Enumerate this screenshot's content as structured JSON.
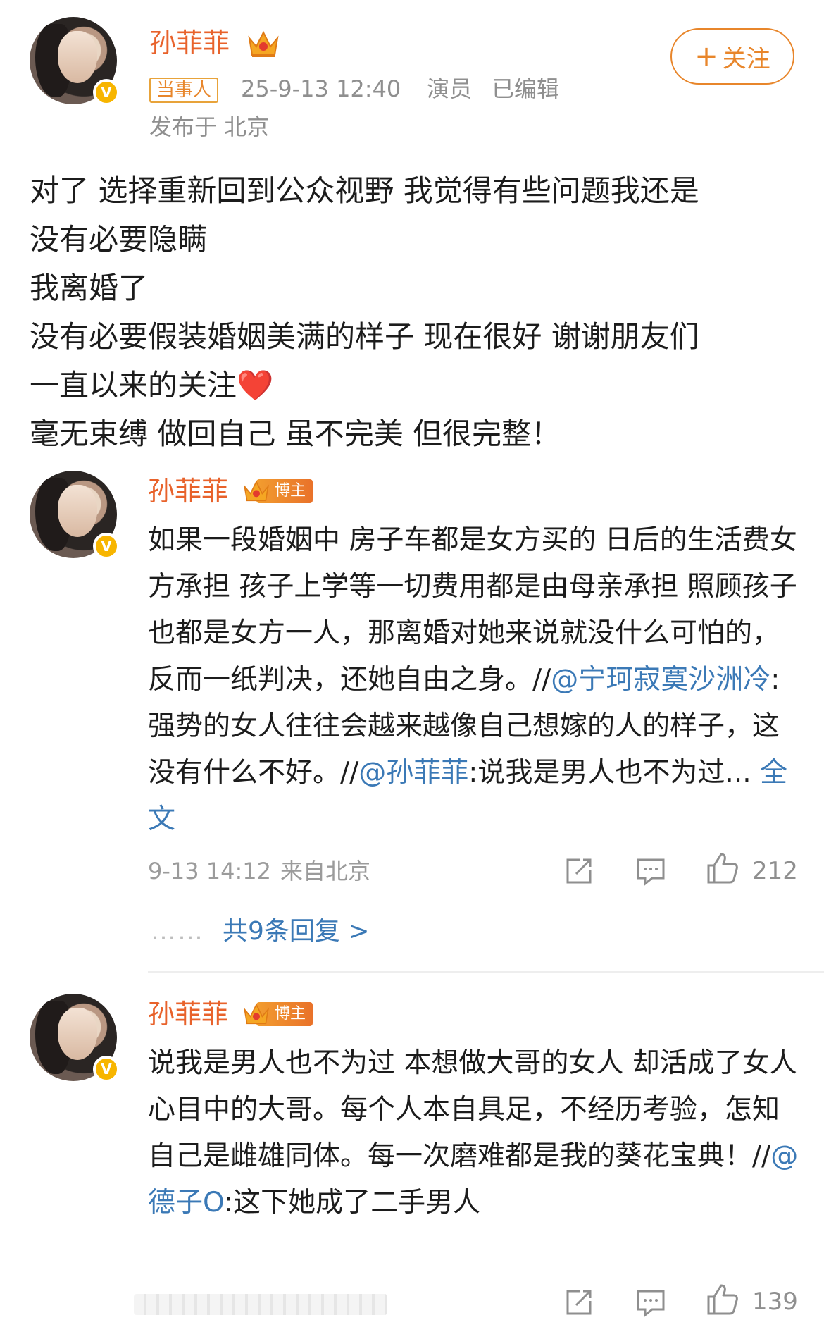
{
  "post": {
    "author": "孙菲菲",
    "tag": "当事人",
    "time": "25-9-13 12:40",
    "role": "演员",
    "edited": "已编辑",
    "location": "发布于 北京",
    "follow_label": "关注",
    "lines": [
      "对了 选择重新回到公众视野 我觉得有些问题我还是",
      "没有必要隐瞒",
      "我离婚了",
      "没有必要假装婚姻美满的样子 现在很好 谢谢朋友们",
      "一直以来的关注❤️",
      "毫无束缚 做回自己 虽不完美 但很完整！"
    ]
  },
  "comments": [
    {
      "author": "孙菲菲",
      "badge": "博主",
      "text_before": "如果一段婚姻中 房子车都是女方买的 日后的生活费女方承担  孩子上学等一切费用都是由母亲承担  照顾孩子也都是女方一人，那离婚对她来说就没什么可怕的，反而一纸判决，还她自由之身。//",
      "mention1": "@宁珂寂寞沙洲冷",
      "text_mid": ":强势的女人往往会越来越像自己想嫁的人的样子，这没有什么不好。//",
      "mention2": "@孙菲菲",
      "text_after": ":说我是男人也不为过... ",
      "more_label": "全文",
      "time": "9-13 14:12",
      "source": "来自北京",
      "likes": "212",
      "replies_label": "共9条回复 >"
    },
    {
      "author": "孙菲菲",
      "badge": "博主",
      "text_before": "说我是男人也不为过 本想做大哥的女人 却活成了女人心目中的大哥。每个人本自具足，不经历考验，怎知自己是雌雄同体。每一次磨难都是我的葵花宝典！//",
      "mention1": "@德子O",
      "text_after": ":这下她成了二手男人",
      "likes": "139"
    }
  ],
  "colors": {
    "name_orange": "#e8622b",
    "link_blue": "#3b79b6",
    "badge_gold": "#f7b500"
  }
}
